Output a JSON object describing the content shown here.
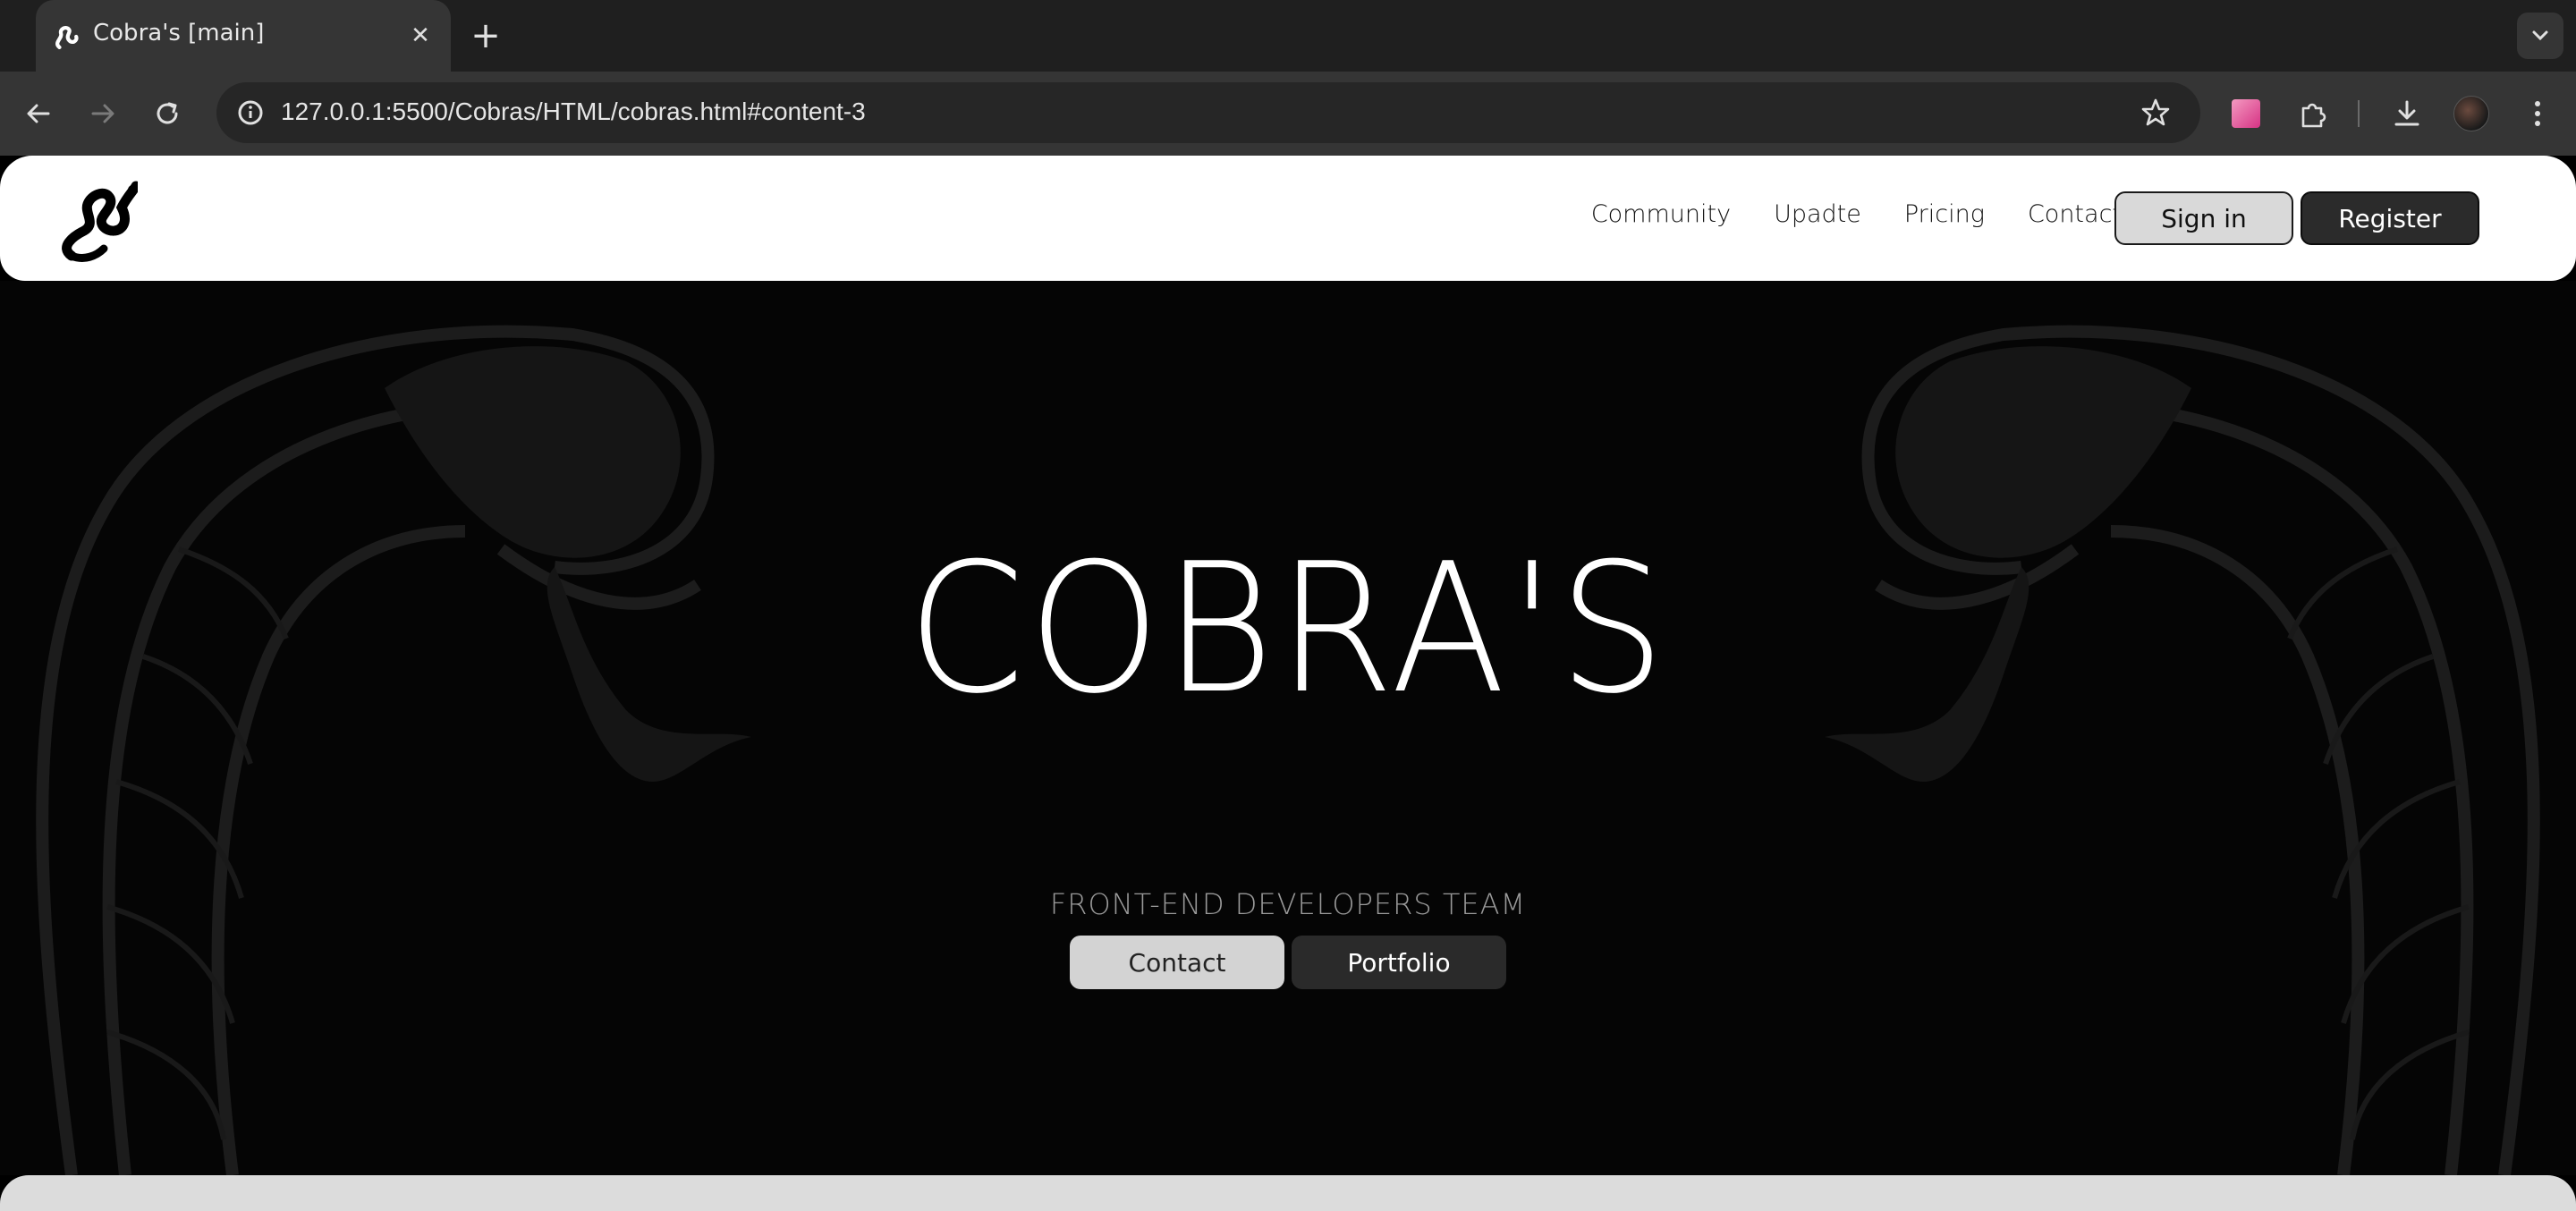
{
  "browser": {
    "tab_title": "Cobra's [main]",
    "tab_close_glyph": "✕",
    "new_tab_glyph": "+",
    "url": "127.0.0.1:5500/Cobras/HTML/cobras.html#content-3",
    "icons": [
      "back-icon",
      "forward-icon",
      "reload-icon",
      "site-info-icon",
      "bookmark-star-icon",
      "extension-color-icon",
      "extensions-puzzle-icon",
      "download-icon",
      "profile-avatar-icon",
      "more-menu-icon",
      "tab-list-chevron-icon"
    ]
  },
  "navbar": {
    "links": [
      "Community",
      "Upadte",
      "Pricing",
      "Contact"
    ],
    "signin_label": "Sign in",
    "register_label": "Register"
  },
  "hero": {
    "title": "COBRA'S",
    "subtitle": "FRONT-END DEVELOPERS TEAM",
    "contact_label": "Contact",
    "portfolio_label": "Portfolio"
  },
  "colors": {
    "chrome_tabbar": "#1f1f1f",
    "chrome_toolbar": "#353535",
    "page_background": "#000000",
    "navbar_background": "#ffffff",
    "accent_dark": "#2b2b2b",
    "accent_light": "#d9d9d9"
  }
}
